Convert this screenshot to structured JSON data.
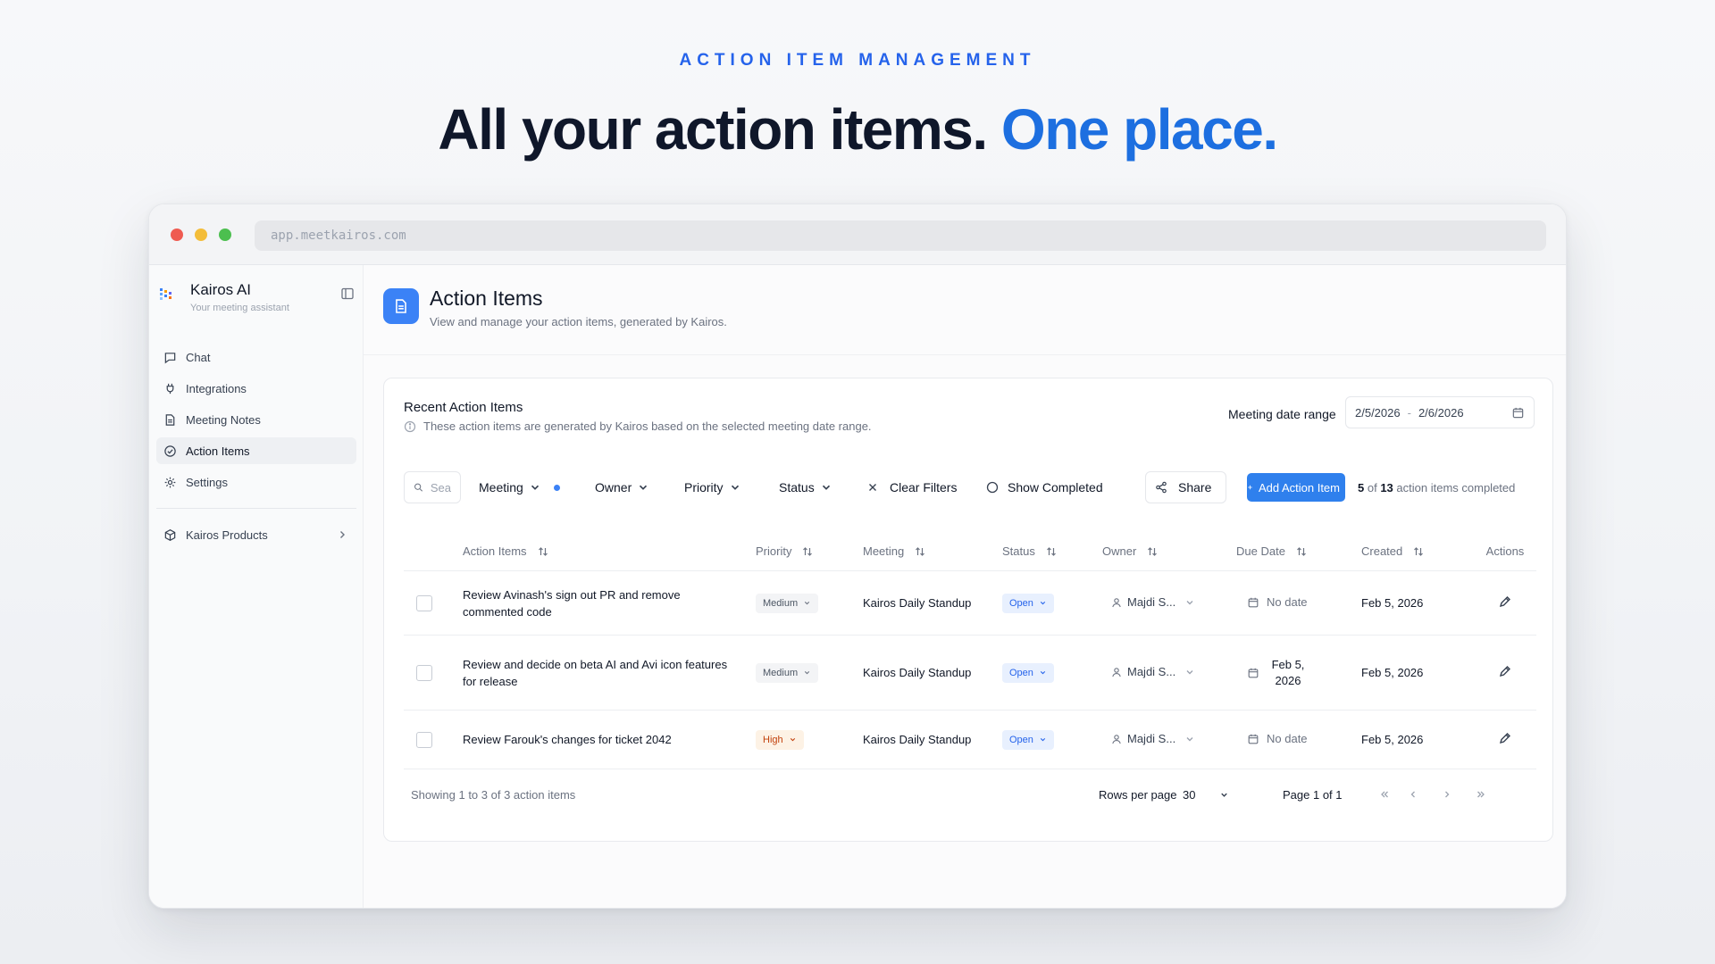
{
  "hero": {
    "kicker": "ACTION ITEM MANAGEMENT",
    "title_main": "All your action items.",
    "title_accent": "One place."
  },
  "browser": {
    "url": "app.meetkairos.com"
  },
  "sidebar": {
    "brand_name": "Kairos AI",
    "brand_sub": "Your meeting assistant",
    "items": [
      {
        "label": "Chat",
        "icon": "chat-icon"
      },
      {
        "label": "Integrations",
        "icon": "plug-icon"
      },
      {
        "label": "Meeting Notes",
        "icon": "notes-icon"
      },
      {
        "label": "Action Items",
        "icon": "check-circle-icon",
        "active": true
      },
      {
        "label": "Settings",
        "icon": "gear-icon"
      }
    ],
    "products_label": "Kairos Products"
  },
  "page": {
    "title": "Action Items",
    "subtitle": "View and manage your action items, generated by Kairos."
  },
  "card": {
    "title": "Recent Action Items",
    "info": "These action items are generated by Kairos based on the selected meeting date range.",
    "range_label": "Meeting date range",
    "range_start": "2/5/2026",
    "range_sep": "-",
    "range_end": "2/6/2026"
  },
  "toolbar": {
    "search_placeholder": "Sea",
    "meeting": "Meeting",
    "owner": "Owner",
    "priority": "Priority",
    "status": "Status",
    "clear_filters": "Clear Filters",
    "show_completed": "Show Completed",
    "share": "Share",
    "add": "Add Action Item",
    "count_done": "5",
    "count_of": "of",
    "count_total": "13",
    "count_suffix": "action items completed"
  },
  "table": {
    "headers": {
      "item": "Action Items",
      "priority": "Priority",
      "meeting": "Meeting",
      "status": "Status",
      "owner": "Owner",
      "due": "Due Date",
      "created": "Created",
      "actions": "Actions"
    },
    "rows": [
      {
        "item": "Review Avinash's sign out PR and remove commented code",
        "priority": "Medium",
        "meeting": "Kairos Daily Standup",
        "status": "Open",
        "owner": "Majdi S...",
        "due": "No date",
        "created": "Feb 5, 2026"
      },
      {
        "item": "Review and decide on beta AI and Avi icon features for release",
        "priority": "Medium",
        "meeting": "Kairos Daily Standup",
        "status": "Open",
        "owner": "Majdi S...",
        "due": "Feb 5, 2026",
        "created": "Feb 5, 2026"
      },
      {
        "item": "Review Farouk's changes for ticket 2042",
        "priority": "High",
        "meeting": "Kairos Daily Standup",
        "status": "Open",
        "owner": "Majdi S...",
        "due": "No date",
        "created": "Feb 5, 2026"
      }
    ]
  },
  "footer": {
    "showing": "Showing 1 to 3 of 3 action items",
    "rows_per_page_label": "Rows per page",
    "rows_per_page": "30",
    "page_info": "Page 1 of 1"
  },
  "colors": {
    "accent": "#2563eb",
    "button": "#2f80ed",
    "high": "#c2410c"
  }
}
